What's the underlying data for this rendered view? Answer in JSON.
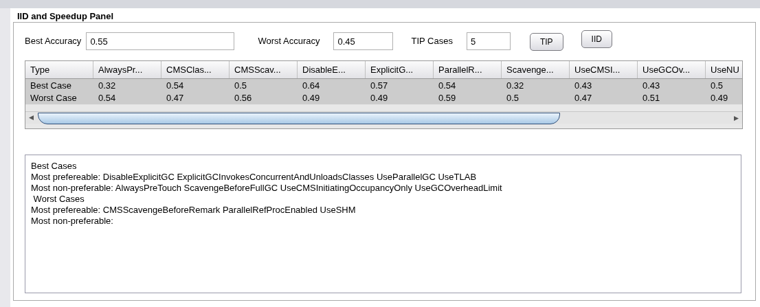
{
  "panel": {
    "title": "IID and Speedup Panel"
  },
  "fields": [
    {
      "label": "Best Accuracy",
      "value": "0.55"
    },
    {
      "label": "Worst Accuracy",
      "value": "0.45"
    },
    {
      "label": "TIP Cases",
      "value": "5"
    }
  ],
  "buttons": [
    "TIP",
    "IID"
  ],
  "table": {
    "columns": [
      "Type",
      "AlwaysPr...",
      "CMSClas...",
      "CMSScav...",
      "DisableE...",
      "ExplicitG...",
      "ParallelR...",
      "Scavenge...",
      "UseCMSI...",
      "UseGCOv...",
      "UseNU"
    ],
    "rows": [
      {
        "selected": true,
        "cells": [
          "Best Case",
          "0.32",
          "0.54",
          "0.5",
          "0.64",
          "0.57",
          "0.54",
          "0.32",
          "0.43",
          "0.43",
          "0.5"
        ]
      },
      {
        "selected": true,
        "cells": [
          "Worst Case",
          "0.54",
          "0.47",
          "0.56",
          "0.49",
          "0.49",
          "0.59",
          "0.5",
          "0.47",
          "0.51",
          "0.49"
        ]
      }
    ]
  },
  "output": {
    "lines": [
      "Best Cases",
      "Most prefereable: DisableExplicitGC ExplicitGCInvokesConcurrentAndUnloadsClasses UseParallelGC UseTLAB",
      "Most non-preferable: AlwaysPreTouch ScavengeBeforeFullGC UseCMSInitiatingOccupancyOnly UseGCOverheadLimit",
      " Worst Cases",
      "Most prefereable: CMSScavengeBeforeRemark ParallelRefProcEnabled UseSHM",
      "Most non-preferable:"
    ]
  }
}
